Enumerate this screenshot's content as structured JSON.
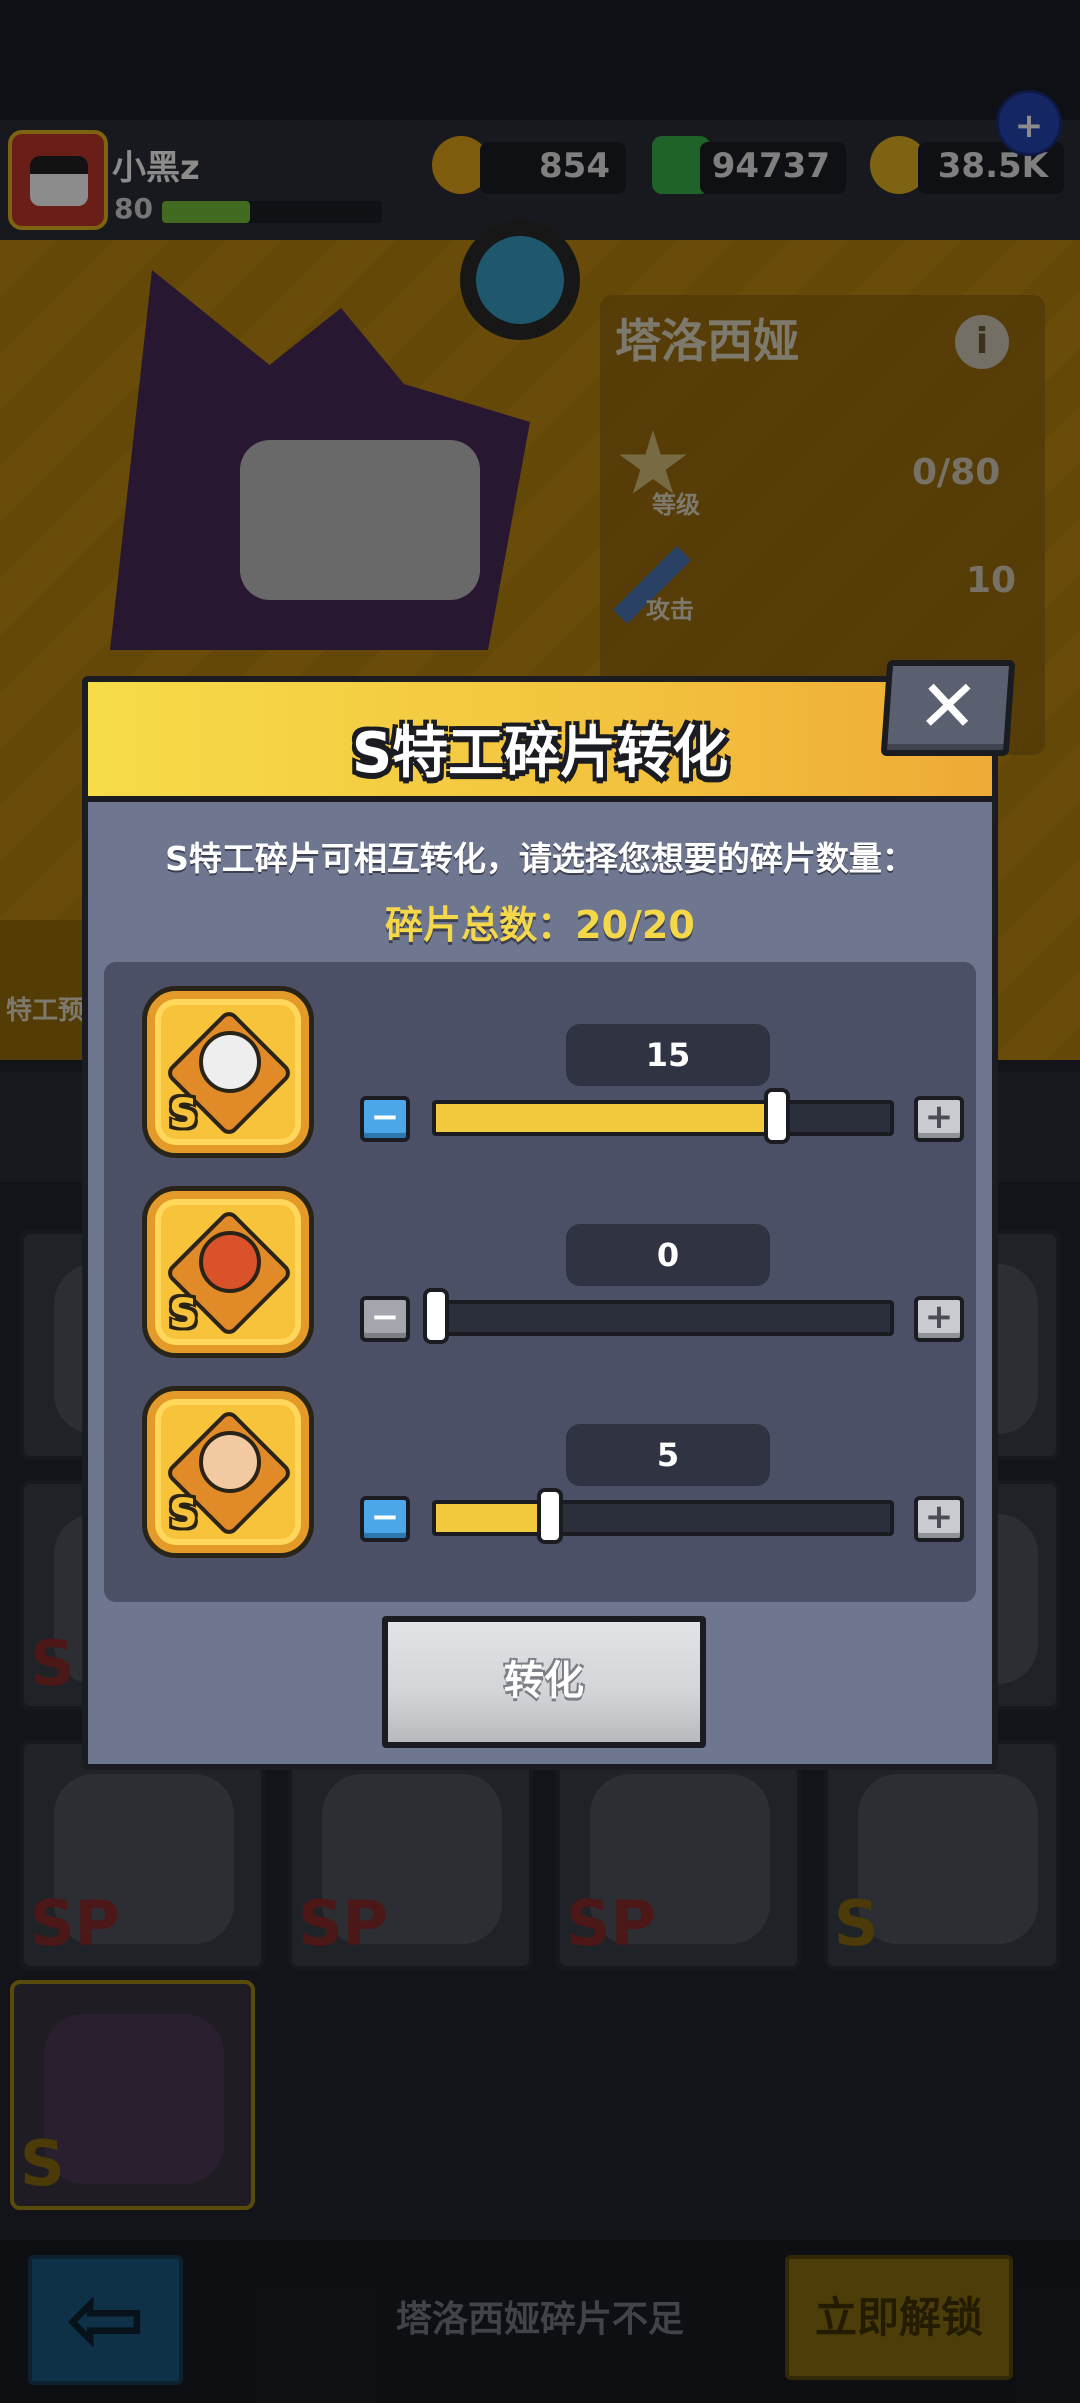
{
  "player": {
    "name": "小黑z",
    "level": "80",
    "exp_fraction": 0.4
  },
  "resources": {
    "gold": "854",
    "gems": "94737",
    "coins": "38.5K"
  },
  "hero": {
    "name": "塔洛西娅",
    "stats": [
      {
        "label": "等级",
        "value": "0/80"
      },
      {
        "label": "攻击",
        "value": "10"
      }
    ],
    "side_label": "特工预"
  },
  "dialog": {
    "title": "S特工碎片转化",
    "description": "S特工碎片可相互转化，请选择您想要的碎片数量：",
    "total_label": "碎片总数：20/20",
    "max": 20,
    "rows": [
      {
        "count": "15",
        "value": 15,
        "portrait_color": "#eeeeee",
        "minus_enabled": true
      },
      {
        "count": "0",
        "value": 0,
        "portrait_color": "#d9522a",
        "minus_enabled": false
      },
      {
        "count": "5",
        "value": 5,
        "portrait_color": "#f2c9a0",
        "minus_enabled": true
      }
    ],
    "convert_label": "转化",
    "close_label": "✕",
    "minus_label": "−",
    "plus_label": "+",
    "s_mark": "S"
  },
  "bottom": {
    "back_label": "⇦",
    "message": "塔洛西娅碎片不足",
    "unlock_label": "立即解锁"
  },
  "plus_button_label": "+",
  "info_label": "i",
  "cards": [
    {
      "badge": "S"
    },
    {
      "badge": "S"
    },
    {
      "badge": "SP"
    },
    {
      "badge": "SP"
    },
    {
      "badge": "SP"
    },
    {
      "badge": "S"
    },
    {
      "badge": "S"
    }
  ]
}
